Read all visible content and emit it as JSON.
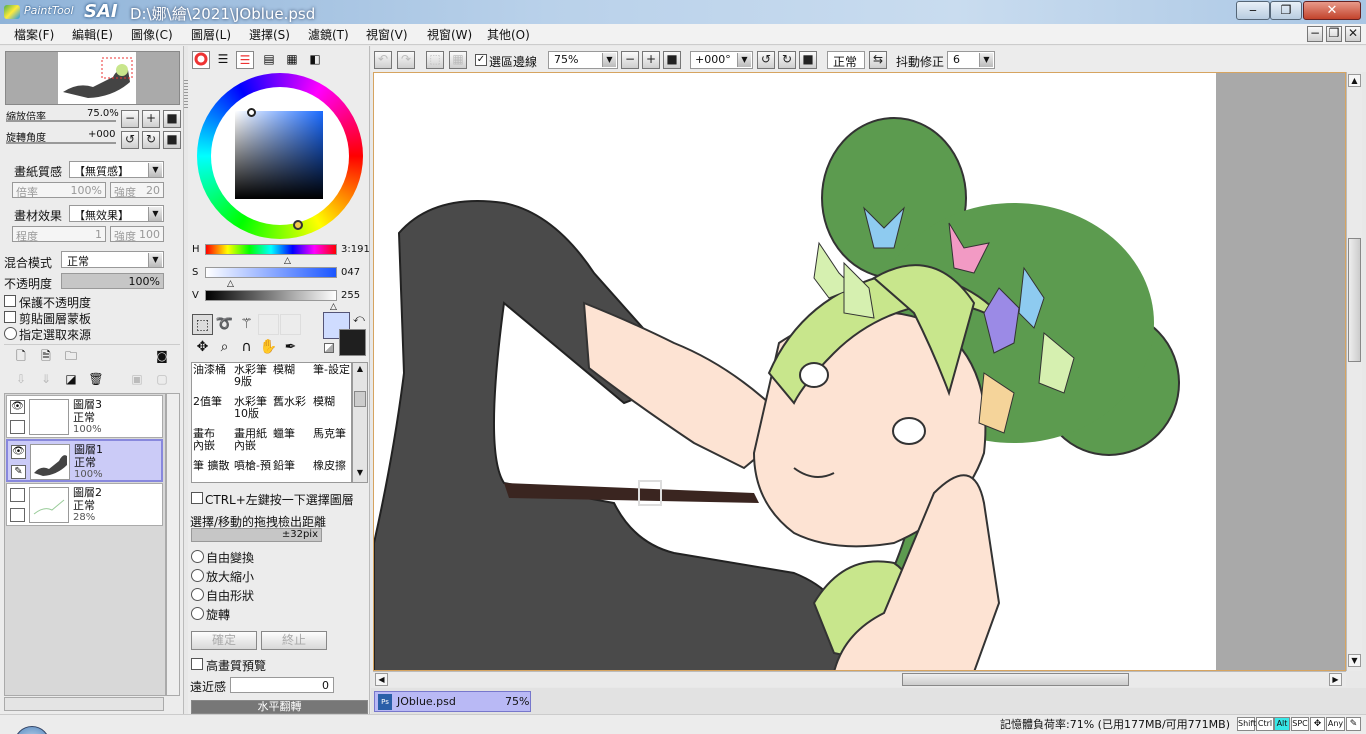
{
  "app": {
    "logo_small": "PaintTool",
    "logo_big": "SAI",
    "title": "D:\\娜\\繪\\2021\\JOblue.psd"
  },
  "window_controls": {
    "minimize": "‒",
    "restore": "❐",
    "close": "✕"
  },
  "menus": [
    "檔案(F)",
    "編輯(E)",
    "圖像(C)",
    "圖層(L)",
    "選擇(S)",
    "濾鏡(T)",
    "視窗(V)",
    "視窗(W)",
    "其他(O)"
  ],
  "doc_controls": {
    "minimize": "−",
    "restore": "❐",
    "close": "✕"
  },
  "navigator": {
    "zoom_label": "縮放倍率",
    "zoom_value": "75.0%",
    "rotate_label": "旋轉角度",
    "rotate_value": "+000"
  },
  "paper": {
    "texture_label": "畫紙質感",
    "texture_value": "【無質感】",
    "scale_label": "倍率",
    "scale_value": "100%",
    "strength_label": "強度",
    "strength_value": "20"
  },
  "effect": {
    "label": "畫材效果",
    "value": "【無效果】",
    "depth_label": "程度",
    "depth_value": "1",
    "strength_label": "強度",
    "strength_value": "100"
  },
  "blend": {
    "label": "混合模式",
    "value": "正常",
    "opacity_label": "不透明度",
    "opacity_value": "100%"
  },
  "layer_options": [
    "保護不透明度",
    "剪貼圖層蒙板",
    "指定選取來源"
  ],
  "layers": [
    {
      "name": "圖層3",
      "mode": "正常",
      "opacity": "100%",
      "selected": false
    },
    {
      "name": "圖層1",
      "mode": "正常",
      "opacity": "100%",
      "selected": true
    },
    {
      "name": "圖層2",
      "mode": "正常",
      "opacity": "28%",
      "selected": false
    }
  ],
  "color": {
    "h_label": "H",
    "h_value": "3:191",
    "s_label": "S",
    "s_value": "047",
    "v_label": "V",
    "v_value": "255",
    "fg": "#cfdcff",
    "bg": "#1f1f1f"
  },
  "brushes": [
    "油漆桶",
    "水彩筆\n9版",
    "模糊",
    "筆-設定",
    "2值筆",
    "水彩筆\n10版",
    "舊水彩",
    "模糊",
    "畫布\n內嵌",
    "畫用紙\n內嵌",
    "蠟筆",
    "馬克筆",
    "筆 擴散",
    "噴槍-預",
    "鉛筆",
    "橡皮擦"
  ],
  "transform": {
    "ctrl_label": "CTRL+左鍵按一下選擇圖層",
    "drag_label": "選擇/移動的拖拽檢出距離",
    "drag_value": "±32pix",
    "options": [
      "自由變換",
      "放大縮小",
      "自由形狀",
      "旋轉"
    ],
    "ok": "確定",
    "cancel": "終止",
    "hq_label": "高畫質預覽",
    "persp_label": "遠近感",
    "persp_value": "0",
    "flip": "水平翻轉"
  },
  "toolbar": {
    "selection_edge": "選區邊線",
    "zoom": "75%",
    "angle": "+000°",
    "mode": "正常",
    "stabilizer_label": "抖動修正",
    "stabilizer_value": "6"
  },
  "tabs": [
    {
      "name": "JOblue.psd",
      "zoom": "75%"
    }
  ],
  "status": {
    "memory": "記憶體負荷率:71% (已用177MB/可用771MB)",
    "keys": [
      "Shift",
      "Ctrl",
      "Alt",
      "SPC",
      "Any"
    ]
  }
}
